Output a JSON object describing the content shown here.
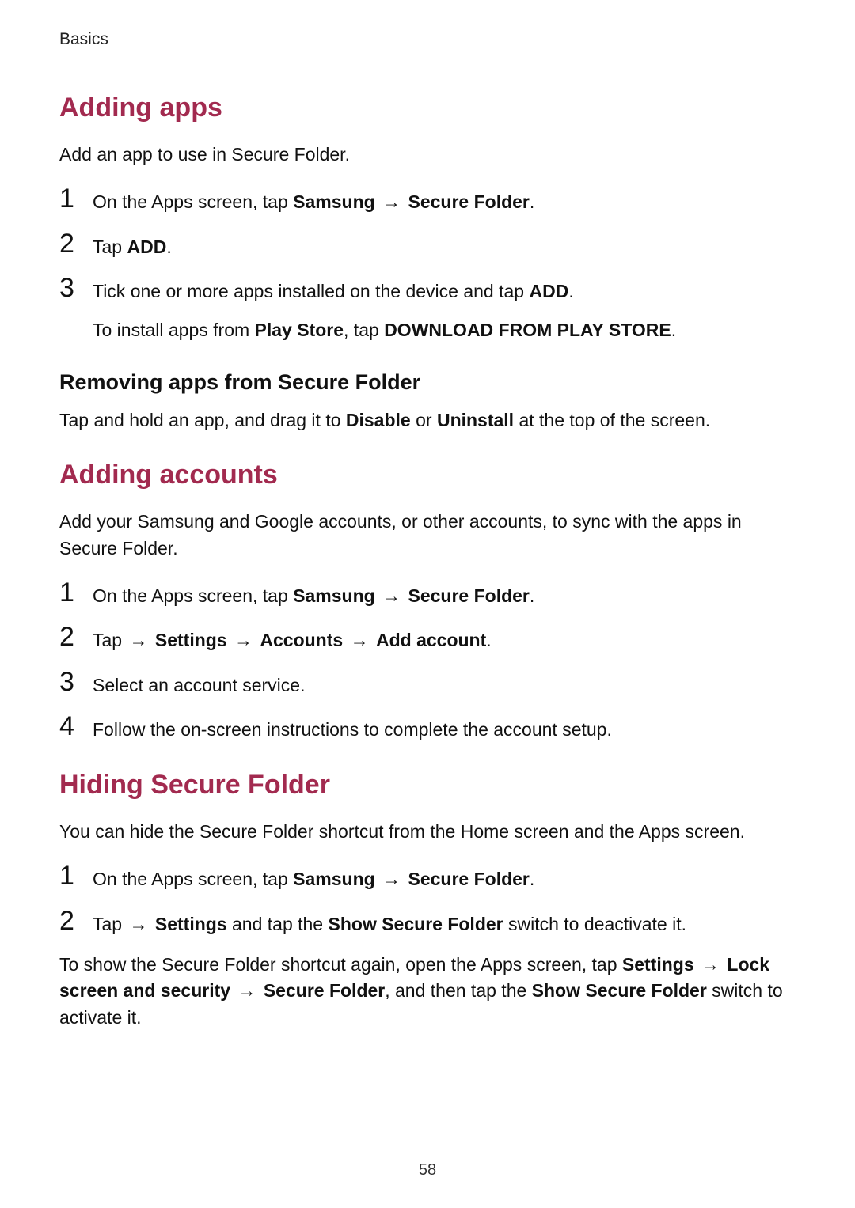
{
  "running_head": "Basics",
  "page_number": "58",
  "arrow": "→",
  "sections": {
    "adding_apps": {
      "title": "Adding apps",
      "intro": "Add an app to use in Secure Folder.",
      "steps": [
        {
          "num": "1",
          "parts": [
            "On the Apps screen, tap ",
            {
              "b": "Samsung"
            },
            " ",
            {
              "arr": true
            },
            " ",
            {
              "b": "Secure Folder"
            },
            "."
          ]
        },
        {
          "num": "2",
          "parts": [
            "Tap ",
            {
              "b": "ADD"
            },
            "."
          ]
        },
        {
          "num": "3",
          "parts": [
            "Tick one or more apps installed on the device and tap ",
            {
              "b": "ADD"
            },
            "."
          ],
          "sub": [
            "To install apps from ",
            {
              "b": "Play Store"
            },
            ", tap ",
            {
              "b": "DOWNLOAD FROM PLAY STORE"
            },
            "."
          ]
        }
      ],
      "subheading": "Removing apps from Secure Folder",
      "subpara": [
        "Tap and hold an app, and drag it to ",
        {
          "b": "Disable"
        },
        " or ",
        {
          "b": "Uninstall"
        },
        " at the top of the screen."
      ]
    },
    "adding_accounts": {
      "title": "Adding accounts",
      "intro": "Add your Samsung and Google accounts, or other accounts, to sync with the apps in Secure Folder.",
      "steps": [
        {
          "num": "1",
          "parts": [
            "On the Apps screen, tap ",
            {
              "b": "Samsung"
            },
            " ",
            {
              "arr": true
            },
            " ",
            {
              "b": "Secure Folder"
            },
            "."
          ]
        },
        {
          "num": "2",
          "parts": [
            "Tap  ",
            {
              "arr": true
            },
            " ",
            {
              "b": "Settings"
            },
            " ",
            {
              "arr": true
            },
            " ",
            {
              "b": "Accounts"
            },
            " ",
            {
              "arr": true
            },
            " ",
            {
              "b": "Add account"
            },
            "."
          ]
        },
        {
          "num": "3",
          "parts": [
            "Select an account service."
          ]
        },
        {
          "num": "4",
          "parts": [
            "Follow the on-screen instructions to complete the account setup."
          ]
        }
      ]
    },
    "hiding": {
      "title": "Hiding Secure Folder",
      "intro": "You can hide the Secure Folder shortcut from the Home screen and the Apps screen.",
      "steps": [
        {
          "num": "1",
          "parts": [
            "On the Apps screen, tap ",
            {
              "b": "Samsung"
            },
            " ",
            {
              "arr": true
            },
            " ",
            {
              "b": "Secure Folder"
            },
            "."
          ]
        },
        {
          "num": "2",
          "parts": [
            "Tap  ",
            {
              "arr": true
            },
            " ",
            {
              "b": "Settings"
            },
            " and tap the ",
            {
              "b": "Show Secure Folder"
            },
            " switch to deactivate it."
          ]
        }
      ],
      "trailing": [
        "To show the Secure Folder shortcut again, open the Apps screen, tap ",
        {
          "b": "Settings"
        },
        " ",
        {
          "arr": true
        },
        " ",
        {
          "b": "Lock screen and security"
        },
        " ",
        {
          "arr": true
        },
        " ",
        {
          "b": "Secure Folder"
        },
        ", and then tap the ",
        {
          "b": "Show Secure Folder"
        },
        " switch to activate it."
      ]
    }
  }
}
